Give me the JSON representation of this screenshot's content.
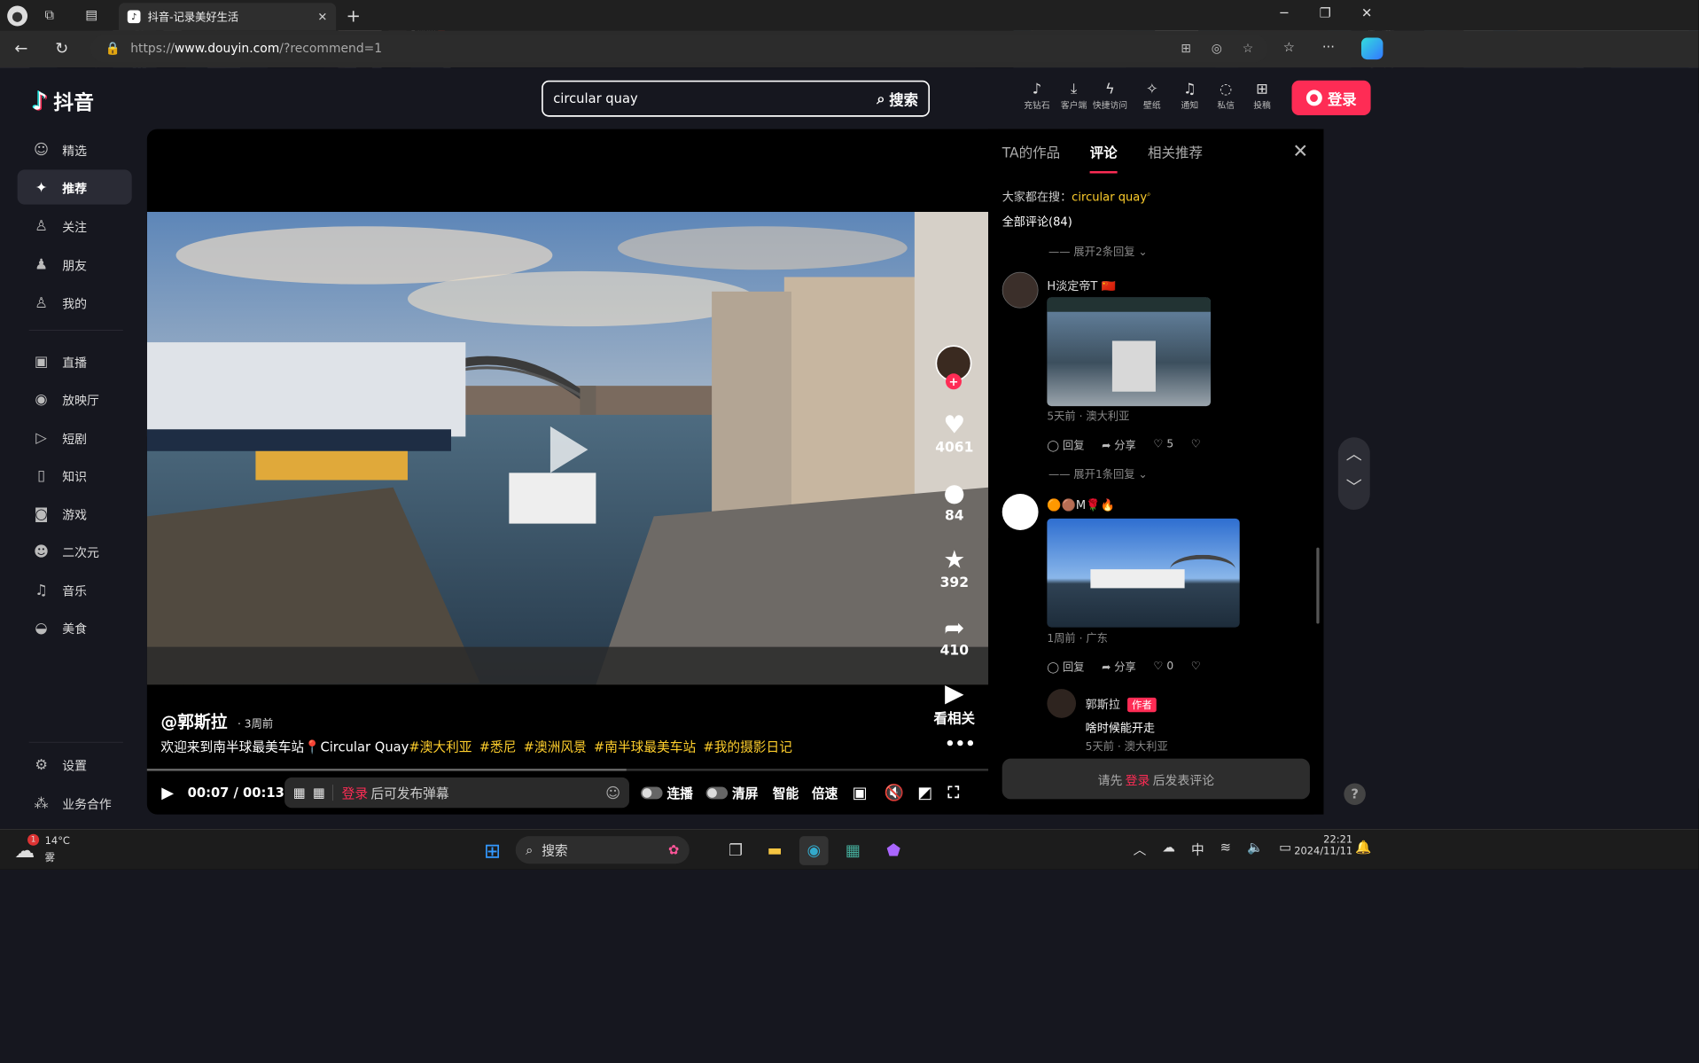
{
  "browser": {
    "tab_title": "抖音-记录美好生活",
    "tab_favicon": "♪",
    "url_prefix": "https://",
    "url_host": "www.douyin.com",
    "url_path": "/?recommend=1"
  },
  "header": {
    "logo_text": "抖音",
    "search_value": "circular quay",
    "search_button": "搜索",
    "icons": [
      {
        "label": "充钻石",
        "icon": "diamond-icon",
        "glyph": "♪"
      },
      {
        "label": "客户端",
        "icon": "download-icon",
        "glyph": "⤓"
      },
      {
        "label": "快捷访问",
        "icon": "bolt-icon",
        "glyph": "ϟ"
      },
      {
        "label": "壁纸",
        "icon": "wallpaper-icon",
        "glyph": "✧"
      },
      {
        "label": "通知",
        "icon": "bell-icon",
        "glyph": "♫"
      },
      {
        "label": "私信",
        "icon": "message-icon",
        "glyph": "◌"
      },
      {
        "label": "投稿",
        "icon": "upload-icon",
        "glyph": "⊞"
      }
    ],
    "login_button": "登录"
  },
  "sidebar": {
    "items": [
      {
        "label": "精选",
        "icon": "featured-icon",
        "glyph": "☺"
      },
      {
        "label": "推荐",
        "icon": "recommend-icon",
        "glyph": "✦"
      },
      {
        "label": "关注",
        "icon": "follow-icon",
        "glyph": "♙"
      },
      {
        "label": "朋友",
        "icon": "friends-icon",
        "glyph": "♟"
      },
      {
        "label": "我的",
        "icon": "me-icon",
        "glyph": "♙"
      },
      {
        "label": "直播",
        "icon": "live-icon",
        "glyph": "▣"
      },
      {
        "label": "放映厅",
        "icon": "cinema-icon",
        "glyph": "◉"
      },
      {
        "label": "短剧",
        "icon": "drama-icon",
        "glyph": "▷"
      },
      {
        "label": "知识",
        "icon": "knowledge-icon",
        "glyph": "▯"
      },
      {
        "label": "游戏",
        "icon": "game-icon",
        "glyph": "◙"
      },
      {
        "label": "二次元",
        "icon": "anime-icon",
        "glyph": "☻"
      },
      {
        "label": "音乐",
        "icon": "music-icon",
        "glyph": "♫"
      },
      {
        "label": "美食",
        "icon": "food-icon",
        "glyph": "◒"
      }
    ],
    "bottom": [
      {
        "label": "设置",
        "icon": "settings-icon",
        "glyph": "⚙"
      },
      {
        "label": "业务合作",
        "icon": "business-icon",
        "glyph": "⁂"
      }
    ]
  },
  "video": {
    "author": "@郭斯拉",
    "posted": "3周前",
    "desc_prefix": "欢迎来到南半球最美车站📍Circular Quay",
    "tags": [
      "#澳大利亚",
      "#悉尼",
      "#澳洲风景",
      "#南半球最美车站",
      "#我的摄影日记"
    ],
    "likes": "4061",
    "comments": "84",
    "favorites": "392",
    "shares": "410",
    "related": "看相关",
    "progress": 0.57,
    "time_current": "00:07",
    "time_sep": "/",
    "time_total": "00:13",
    "danmu_login": "登录",
    "danmu_text": "后可发布弹幕",
    "controls": {
      "autoplay": "连播",
      "clear": "清屏",
      "smart": "智能",
      "speed": "倍速"
    }
  },
  "comments": {
    "tabs": [
      "TA的作品",
      "评论",
      "相关推荐"
    ],
    "active_tab": 1,
    "hot_prefix": "大家都在搜：",
    "hot_query": "circular quay",
    "all_count": "全部评论(84)",
    "expand_2": "展开2条回复",
    "expand_1": "展开1条回复",
    "items": [
      {
        "name": "H淡定帝T 🇨🇳",
        "meta": "5天前 · 澳大利亚",
        "reply": "回复",
        "share": "分享",
        "likes": "5"
      },
      {
        "name": "🟠🟤M🌹🔥",
        "meta": "1周前 · 广东",
        "reply": "回复",
        "share": "分享",
        "likes": "0"
      }
    ],
    "author_reply": {
      "name": "郭斯拉",
      "badge": "作者",
      "text": "啥时候能开走",
      "meta": "5天前 · 澳大利亚"
    },
    "input_prefix": "请先",
    "input_login": "登录",
    "input_suffix": "后发表评论"
  },
  "taskbar": {
    "weather_temp": "14°C",
    "weather_desc": "雾",
    "weather_badge": "1",
    "search_label": "搜索",
    "ime": "中",
    "time": "22:21",
    "date": "2024/11/11"
  }
}
